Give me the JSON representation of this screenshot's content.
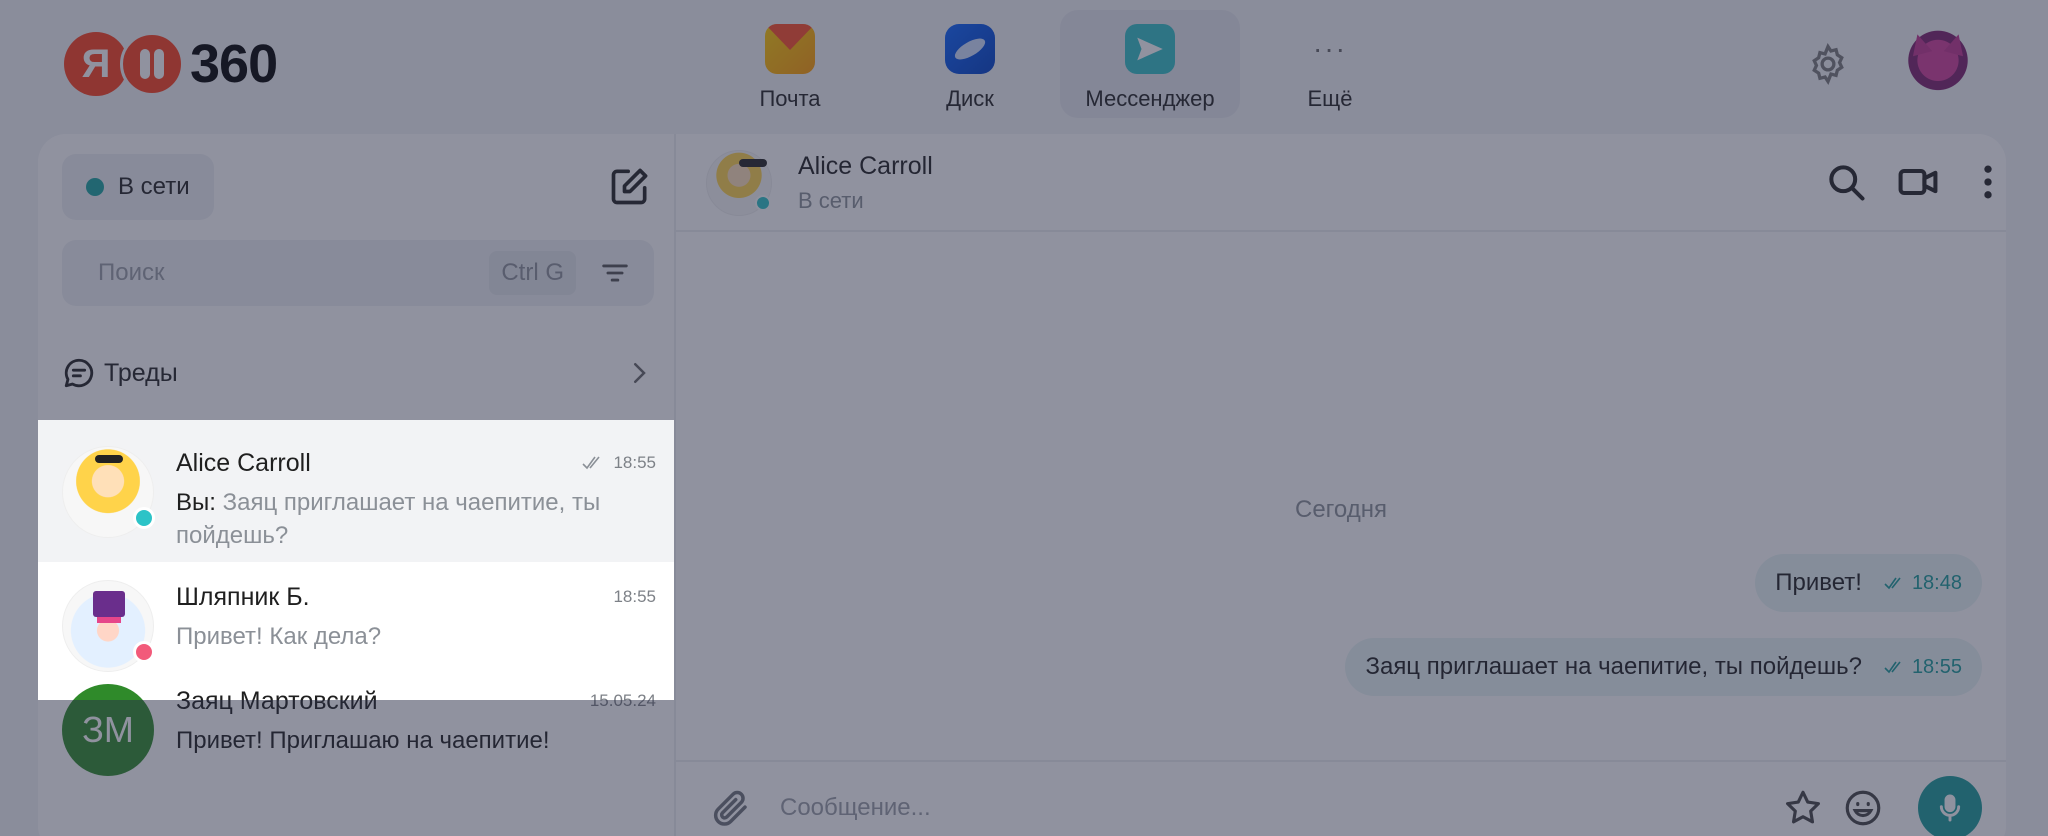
{
  "brand": {
    "logo_letter": "Я",
    "logo_text": "360",
    "accent": "#fc3f1d"
  },
  "apps": [
    {
      "label": "Почта",
      "icon": "mail-icon"
    },
    {
      "label": "Диск",
      "icon": "disk-icon"
    },
    {
      "label": "Мессенджер",
      "icon": "messenger-icon",
      "active": true
    },
    {
      "label": "Ещё",
      "icon": "more-icon"
    }
  ],
  "sidebar": {
    "status_label": "В сети",
    "search_placeholder": "Поиск",
    "search_shortcut": "Ctrl G",
    "threads_label": "Треды"
  },
  "chats": [
    {
      "name": "Alice Carroll",
      "time": "18:55",
      "read_icon": "double-check-icon",
      "preview_prefix": "Вы:",
      "preview": " Заяц приглашает на чаепитие, ты пойдешь?",
      "status_color": "#2cc3c7",
      "selected": true
    },
    {
      "name": "Шляпник Б.",
      "time": "18:55",
      "preview": "Привет! Как дела?",
      "status_color": "#f25a7a"
    },
    {
      "name": "Заяц Мартовский",
      "initials": "ЗМ",
      "time": "15.05.24",
      "preview": "Привет! Приглашаю на чаепитие!"
    }
  ],
  "conversation": {
    "name": "Alice Carroll",
    "status": "В сети",
    "day_label": "Сегодня",
    "messages": [
      {
        "text": "Привет!",
        "time": "18:48"
      },
      {
        "text": "Заяц приглашает на чаепитие, ты пойдешь?",
        "time": "18:55"
      }
    ],
    "input_placeholder": "Сообщение..."
  }
}
